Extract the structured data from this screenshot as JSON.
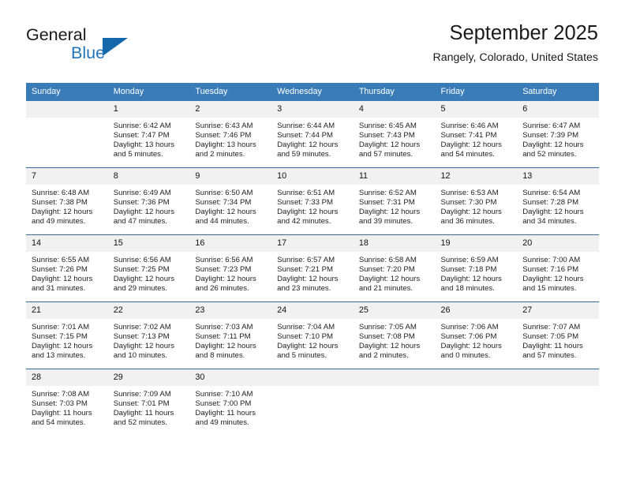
{
  "brand": {
    "name_top": "General",
    "name_bottom": "Blue",
    "triangle_color": "#1567ac",
    "blue_text_color": "#2574b8"
  },
  "header": {
    "title": "September 2025",
    "subtitle": "Rangely, Colorado, United States"
  },
  "theme": {
    "header_row_bg": "#3a7cb8",
    "row_divider": "#2e6da4",
    "daynum_bg": "#f1f1f1",
    "text": "#222222"
  },
  "weekday_headers": [
    "Sunday",
    "Monday",
    "Tuesday",
    "Wednesday",
    "Thursday",
    "Friday",
    "Saturday"
  ],
  "weeks": [
    [
      {
        "day": "",
        "empty": true,
        "sunrise": "",
        "sunset": "",
        "daylight_line1": "",
        "daylight_line2": ""
      },
      {
        "day": "1",
        "sunrise": "Sunrise: 6:42 AM",
        "sunset": "Sunset: 7:47 PM",
        "daylight_line1": "Daylight: 13 hours",
        "daylight_line2": "and 5 minutes."
      },
      {
        "day": "2",
        "sunrise": "Sunrise: 6:43 AM",
        "sunset": "Sunset: 7:46 PM",
        "daylight_line1": "Daylight: 13 hours",
        "daylight_line2": "and 2 minutes."
      },
      {
        "day": "3",
        "sunrise": "Sunrise: 6:44 AM",
        "sunset": "Sunset: 7:44 PM",
        "daylight_line1": "Daylight: 12 hours",
        "daylight_line2": "and 59 minutes."
      },
      {
        "day": "4",
        "sunrise": "Sunrise: 6:45 AM",
        "sunset": "Sunset: 7:43 PM",
        "daylight_line1": "Daylight: 12 hours",
        "daylight_line2": "and 57 minutes."
      },
      {
        "day": "5",
        "sunrise": "Sunrise: 6:46 AM",
        "sunset": "Sunset: 7:41 PM",
        "daylight_line1": "Daylight: 12 hours",
        "daylight_line2": "and 54 minutes."
      },
      {
        "day": "6",
        "sunrise": "Sunrise: 6:47 AM",
        "sunset": "Sunset: 7:39 PM",
        "daylight_line1": "Daylight: 12 hours",
        "daylight_line2": "and 52 minutes."
      }
    ],
    [
      {
        "day": "7",
        "sunrise": "Sunrise: 6:48 AM",
        "sunset": "Sunset: 7:38 PM",
        "daylight_line1": "Daylight: 12 hours",
        "daylight_line2": "and 49 minutes."
      },
      {
        "day": "8",
        "sunrise": "Sunrise: 6:49 AM",
        "sunset": "Sunset: 7:36 PM",
        "daylight_line1": "Daylight: 12 hours",
        "daylight_line2": "and 47 minutes."
      },
      {
        "day": "9",
        "sunrise": "Sunrise: 6:50 AM",
        "sunset": "Sunset: 7:34 PM",
        "daylight_line1": "Daylight: 12 hours",
        "daylight_line2": "and 44 minutes."
      },
      {
        "day": "10",
        "sunrise": "Sunrise: 6:51 AM",
        "sunset": "Sunset: 7:33 PM",
        "daylight_line1": "Daylight: 12 hours",
        "daylight_line2": "and 42 minutes."
      },
      {
        "day": "11",
        "sunrise": "Sunrise: 6:52 AM",
        "sunset": "Sunset: 7:31 PM",
        "daylight_line1": "Daylight: 12 hours",
        "daylight_line2": "and 39 minutes."
      },
      {
        "day": "12",
        "sunrise": "Sunrise: 6:53 AM",
        "sunset": "Sunset: 7:30 PM",
        "daylight_line1": "Daylight: 12 hours",
        "daylight_line2": "and 36 minutes."
      },
      {
        "day": "13",
        "sunrise": "Sunrise: 6:54 AM",
        "sunset": "Sunset: 7:28 PM",
        "daylight_line1": "Daylight: 12 hours",
        "daylight_line2": "and 34 minutes."
      }
    ],
    [
      {
        "day": "14",
        "sunrise": "Sunrise: 6:55 AM",
        "sunset": "Sunset: 7:26 PM",
        "daylight_line1": "Daylight: 12 hours",
        "daylight_line2": "and 31 minutes."
      },
      {
        "day": "15",
        "sunrise": "Sunrise: 6:56 AM",
        "sunset": "Sunset: 7:25 PM",
        "daylight_line1": "Daylight: 12 hours",
        "daylight_line2": "and 29 minutes."
      },
      {
        "day": "16",
        "sunrise": "Sunrise: 6:56 AM",
        "sunset": "Sunset: 7:23 PM",
        "daylight_line1": "Daylight: 12 hours",
        "daylight_line2": "and 26 minutes."
      },
      {
        "day": "17",
        "sunrise": "Sunrise: 6:57 AM",
        "sunset": "Sunset: 7:21 PM",
        "daylight_line1": "Daylight: 12 hours",
        "daylight_line2": "and 23 minutes."
      },
      {
        "day": "18",
        "sunrise": "Sunrise: 6:58 AM",
        "sunset": "Sunset: 7:20 PM",
        "daylight_line1": "Daylight: 12 hours",
        "daylight_line2": "and 21 minutes."
      },
      {
        "day": "19",
        "sunrise": "Sunrise: 6:59 AM",
        "sunset": "Sunset: 7:18 PM",
        "daylight_line1": "Daylight: 12 hours",
        "daylight_line2": "and 18 minutes."
      },
      {
        "day": "20",
        "sunrise": "Sunrise: 7:00 AM",
        "sunset": "Sunset: 7:16 PM",
        "daylight_line1": "Daylight: 12 hours",
        "daylight_line2": "and 15 minutes."
      }
    ],
    [
      {
        "day": "21",
        "sunrise": "Sunrise: 7:01 AM",
        "sunset": "Sunset: 7:15 PM",
        "daylight_line1": "Daylight: 12 hours",
        "daylight_line2": "and 13 minutes."
      },
      {
        "day": "22",
        "sunrise": "Sunrise: 7:02 AM",
        "sunset": "Sunset: 7:13 PM",
        "daylight_line1": "Daylight: 12 hours",
        "daylight_line2": "and 10 minutes."
      },
      {
        "day": "23",
        "sunrise": "Sunrise: 7:03 AM",
        "sunset": "Sunset: 7:11 PM",
        "daylight_line1": "Daylight: 12 hours",
        "daylight_line2": "and 8 minutes."
      },
      {
        "day": "24",
        "sunrise": "Sunrise: 7:04 AM",
        "sunset": "Sunset: 7:10 PM",
        "daylight_line1": "Daylight: 12 hours",
        "daylight_line2": "and 5 minutes."
      },
      {
        "day": "25",
        "sunrise": "Sunrise: 7:05 AM",
        "sunset": "Sunset: 7:08 PM",
        "daylight_line1": "Daylight: 12 hours",
        "daylight_line2": "and 2 minutes."
      },
      {
        "day": "26",
        "sunrise": "Sunrise: 7:06 AM",
        "sunset": "Sunset: 7:06 PM",
        "daylight_line1": "Daylight: 12 hours",
        "daylight_line2": "and 0 minutes."
      },
      {
        "day": "27",
        "sunrise": "Sunrise: 7:07 AM",
        "sunset": "Sunset: 7:05 PM",
        "daylight_line1": "Daylight: 11 hours",
        "daylight_line2": "and 57 minutes."
      }
    ],
    [
      {
        "day": "28",
        "sunrise": "Sunrise: 7:08 AM",
        "sunset": "Sunset: 7:03 PM",
        "daylight_line1": "Daylight: 11 hours",
        "daylight_line2": "and 54 minutes."
      },
      {
        "day": "29",
        "sunrise": "Sunrise: 7:09 AM",
        "sunset": "Sunset: 7:01 PM",
        "daylight_line1": "Daylight: 11 hours",
        "daylight_line2": "and 52 minutes."
      },
      {
        "day": "30",
        "sunrise": "Sunrise: 7:10 AM",
        "sunset": "Sunset: 7:00 PM",
        "daylight_line1": "Daylight: 11 hours",
        "daylight_line2": "and 49 minutes."
      },
      {
        "day": "",
        "empty": true,
        "sunrise": "",
        "sunset": "",
        "daylight_line1": "",
        "daylight_line2": ""
      },
      {
        "day": "",
        "empty": true,
        "sunrise": "",
        "sunset": "",
        "daylight_line1": "",
        "daylight_line2": ""
      },
      {
        "day": "",
        "empty": true,
        "sunrise": "",
        "sunset": "",
        "daylight_line1": "",
        "daylight_line2": ""
      },
      {
        "day": "",
        "empty": true,
        "sunrise": "",
        "sunset": "",
        "daylight_line1": "",
        "daylight_line2": ""
      }
    ]
  ]
}
